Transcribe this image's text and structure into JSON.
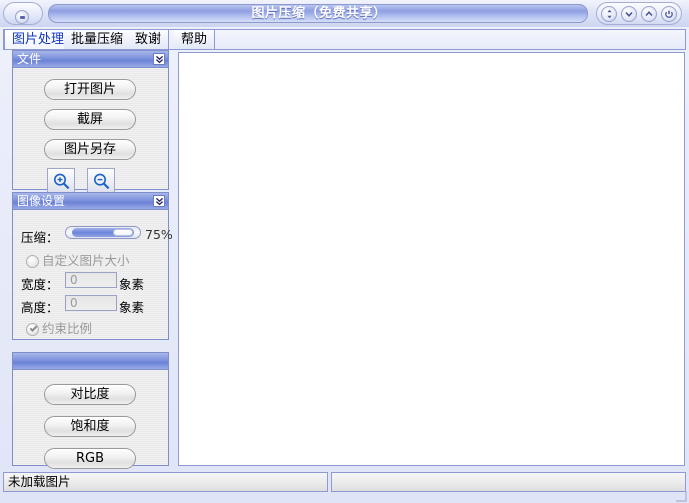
{
  "window": {
    "title": "图片压缩（免费共享）",
    "app_icon": "app-orb-icon",
    "controls": [
      {
        "name": "restore-button",
        "glyph": "resize-arrows-icon"
      },
      {
        "name": "minimize-button",
        "glyph": "chevron-down-icon"
      },
      {
        "name": "maximize-button",
        "glyph": "chevron-up-icon"
      },
      {
        "name": "close-button",
        "glyph": "power-icon"
      }
    ]
  },
  "tabs": [
    {
      "label": "图片处理",
      "active": true
    },
    {
      "label": "批量压缩",
      "active": false
    },
    {
      "label": "致谢",
      "active": false
    },
    {
      "label": "帮助",
      "active": false
    }
  ],
  "file_panel": {
    "title": "文件",
    "collapse_icon": "double-chevron-down-icon",
    "buttons": [
      {
        "label": "打开图片"
      },
      {
        "label": "截屏"
      },
      {
        "label": "图片另存"
      }
    ],
    "zoom_in_icon": "magnifier-plus-icon",
    "zoom_out_icon": "magnifier-minus-icon"
  },
  "image_settings_panel": {
    "title": "图像设置",
    "collapse_icon": "double-chevron-down-icon",
    "compression_label": "压缩：",
    "compression_value": "75%",
    "compression_percent": 75,
    "custom_size_label": "自定义图片大小",
    "custom_size_checked": false,
    "width_label": "宽度：",
    "width_value": "0",
    "width_unit": "象素",
    "height_label": "高度：",
    "height_value": "0",
    "height_unit": "象素",
    "constrain_label": "约束比例",
    "constrain_checked": true
  },
  "adjust_panel": {
    "title": "",
    "buttons": [
      {
        "label": "对比度"
      },
      {
        "label": "饱和度"
      },
      {
        "label": "RGB"
      }
    ]
  },
  "statusbar": {
    "left_text": "未加载图片",
    "right_text": ""
  },
  "colors": {
    "title_blue": "#6c83d6",
    "panel_header_blue": "#7d92dd",
    "active_tab_text": "#1034c0",
    "frame_border": "#8f9ad4",
    "canvas_bg": "#ffffff"
  }
}
